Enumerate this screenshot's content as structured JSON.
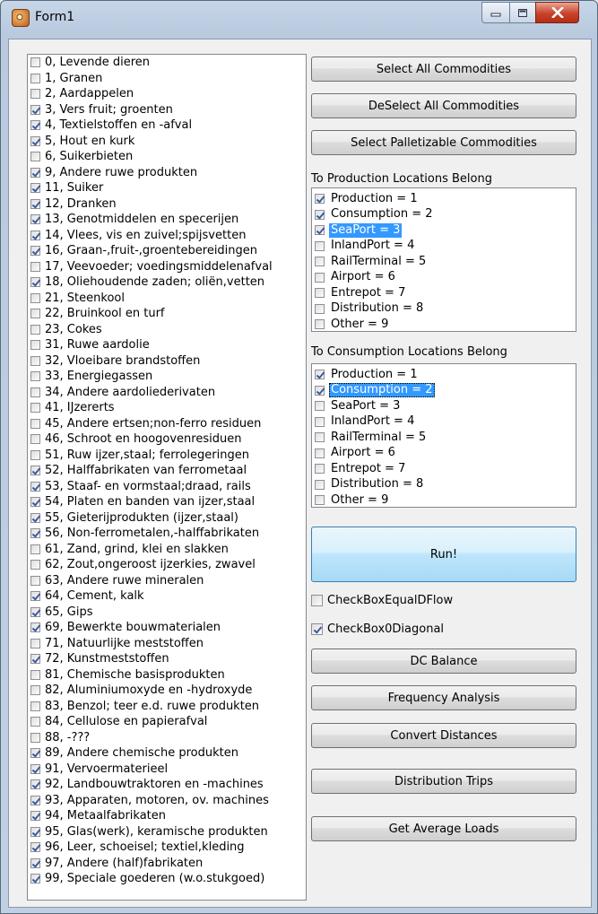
{
  "window": {
    "title": "Form1"
  },
  "commodities": [
    {
      "label": "0, Levende dieren",
      "checked": false
    },
    {
      "label": "1, Granen",
      "checked": false
    },
    {
      "label": "2, Aardappelen",
      "checked": false
    },
    {
      "label": "3, Vers fruit; groenten",
      "checked": true
    },
    {
      "label": "4, Textielstoffen en -afval",
      "checked": true
    },
    {
      "label": "5, Hout en kurk",
      "checked": true
    },
    {
      "label": "6, Suikerbieten",
      "checked": false
    },
    {
      "label": "9, Andere ruwe produkten",
      "checked": true
    },
    {
      "label": "11, Suiker",
      "checked": true
    },
    {
      "label": "12, Dranken",
      "checked": true
    },
    {
      "label": "13, Genotmiddelen en specerijen",
      "checked": true
    },
    {
      "label": "14, Vlees, vis en zuivel;spijsvetten",
      "checked": true
    },
    {
      "label": "16, Graan-,fruit-,groentebereidingen",
      "checked": true
    },
    {
      "label": "17, Veevoeder; voedingsmiddelenafval",
      "checked": false
    },
    {
      "label": "18, Oliehoudende zaden; oliën,vetten",
      "checked": true
    },
    {
      "label": "21, Steenkool",
      "checked": false
    },
    {
      "label": "22, Bruinkool en turf",
      "checked": false
    },
    {
      "label": "23, Cokes",
      "checked": false
    },
    {
      "label": "31, Ruwe aardolie",
      "checked": false
    },
    {
      "label": "32, Vloeibare brandstoffen",
      "checked": false
    },
    {
      "label": "33, Energiegassen",
      "checked": false
    },
    {
      "label": "34, Andere aardoliederivaten",
      "checked": false
    },
    {
      "label": "41, IJzererts",
      "checked": false
    },
    {
      "label": "45, Andere ertsen;non-ferro residuen",
      "checked": false
    },
    {
      "label": "46, Schroot en hoogovenresiduen",
      "checked": false
    },
    {
      "label": "51, Ruw ijzer,staal; ferrolegeringen",
      "checked": false
    },
    {
      "label": "52, Halffabrikaten van ferrometaal",
      "checked": true
    },
    {
      "label": "53, Staaf- en vormstaal;draad, rails",
      "checked": true
    },
    {
      "label": "54, Platen en banden van ijzer,staal",
      "checked": true
    },
    {
      "label": "55, Gieterijprodukten (ijzer,staal)",
      "checked": true
    },
    {
      "label": "56, Non-ferrometalen,-halffabrikaten",
      "checked": true
    },
    {
      "label": "61, Zand, grind, klei en slakken",
      "checked": false
    },
    {
      "label": "62, Zout,ongeroost ijzerkies, zwavel",
      "checked": false
    },
    {
      "label": "63, Andere ruwe mineralen",
      "checked": false
    },
    {
      "label": "64, Cement, kalk",
      "checked": true
    },
    {
      "label": "65, Gips",
      "checked": true
    },
    {
      "label": "69, Bewerkte bouwmaterialen",
      "checked": true
    },
    {
      "label": "71, Natuurlijke meststoffen",
      "checked": false
    },
    {
      "label": "72, Kunstmeststoffen",
      "checked": true
    },
    {
      "label": "81, Chemische basisprodukten",
      "checked": false
    },
    {
      "label": "82, Aluminiumoxyde en -hydroxyde",
      "checked": false
    },
    {
      "label": "83, Benzol; teer e.d. ruwe produkten",
      "checked": false
    },
    {
      "label": "84, Cellulose en papierafval",
      "checked": false
    },
    {
      "label": "88, -???",
      "checked": false
    },
    {
      "label": "89, Andere chemische produkten",
      "checked": true
    },
    {
      "label": "91, Vervoermaterieel",
      "checked": true
    },
    {
      "label": "92, Landbouwtraktoren en -machines",
      "checked": true
    },
    {
      "label": "93, Apparaten, motoren, ov. machines",
      "checked": true
    },
    {
      "label": "94, Metaalfabrikaten",
      "checked": true
    },
    {
      "label": "95, Glas(werk), keramische produkten",
      "checked": true
    },
    {
      "label": "96, Leer, schoeisel; textiel,kleding",
      "checked": true
    },
    {
      "label": "97, Andere (half)fabrikaten",
      "checked": true
    },
    {
      "label": "99, Speciale goederen (w.o.stukgoed)",
      "checked": true
    }
  ],
  "buttons": {
    "select_all": "Select All Commodities",
    "deselect_all": "DeSelect All Commodities",
    "select_palletizable": "Select Palletizable Commodities",
    "run": "Run!",
    "dc_balance": "DC Balance",
    "frequency_analysis": "Frequency Analysis",
    "convert_distances": "Convert Distances",
    "distribution_trips": "Distribution Trips",
    "get_average_loads": "Get Average Loads"
  },
  "production": {
    "label": "To Production Locations Belong",
    "items": [
      {
        "label": "Production = 1",
        "checked": true,
        "selected": false,
        "focused": false
      },
      {
        "label": "Consumption = 2",
        "checked": true,
        "selected": false,
        "focused": false
      },
      {
        "label": "SeaPort = 3",
        "checked": true,
        "selected": true,
        "focused": false
      },
      {
        "label": "InlandPort = 4",
        "checked": false,
        "selected": false,
        "focused": false
      },
      {
        "label": "RailTerminal = 5",
        "checked": false,
        "selected": false,
        "focused": false
      },
      {
        "label": "Airport = 6",
        "checked": false,
        "selected": false,
        "focused": false
      },
      {
        "label": "Entrepot = 7",
        "checked": false,
        "selected": false,
        "focused": false
      },
      {
        "label": "Distribution = 8",
        "checked": false,
        "selected": false,
        "focused": false
      },
      {
        "label": "Other = 9",
        "checked": false,
        "selected": false,
        "focused": false
      }
    ]
  },
  "consumption": {
    "label": "To Consumption Locations Belong",
    "items": [
      {
        "label": "Production = 1",
        "checked": true,
        "selected": false,
        "focused": false
      },
      {
        "label": "Consumption = 2",
        "checked": true,
        "selected": true,
        "focused": true
      },
      {
        "label": "SeaPort = 3",
        "checked": false,
        "selected": false,
        "focused": false
      },
      {
        "label": "InlandPort = 4",
        "checked": false,
        "selected": false,
        "focused": false
      },
      {
        "label": "RailTerminal = 5",
        "checked": false,
        "selected": false,
        "focused": false
      },
      {
        "label": "Airport = 6",
        "checked": false,
        "selected": false,
        "focused": false
      },
      {
        "label": "Entrepot = 7",
        "checked": false,
        "selected": false,
        "focused": false
      },
      {
        "label": "Distribution = 8",
        "checked": false,
        "selected": false,
        "focused": false
      },
      {
        "label": "Other = 9",
        "checked": false,
        "selected": false,
        "focused": false
      }
    ]
  },
  "checkboxes": {
    "equal_dflow": {
      "label": "CheckBoxEqualDFlow",
      "checked": false
    },
    "zero_diagonal": {
      "label": "CheckBox0Diagonal",
      "checked": true
    }
  },
  "icons": {
    "app": "app-icon",
    "minimize": "minimize-icon",
    "maximize": "maximize-icon",
    "close": "close-icon"
  },
  "colors": {
    "selection": "#3399ff",
    "run_button": "#bee6fd",
    "close_button": "#c8432a"
  }
}
